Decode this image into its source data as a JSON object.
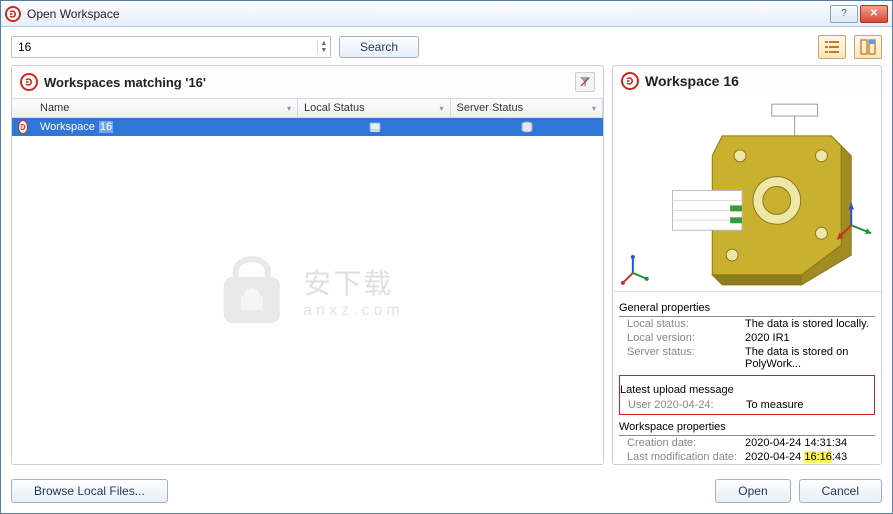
{
  "window": {
    "title": "Open Workspace"
  },
  "toolbar": {
    "search_value": "16",
    "search_btn": "Search"
  },
  "left_panel": {
    "title": "Workspaces matching '16'",
    "columns": {
      "name": "Name",
      "local": "Local Status",
      "server": "Server Status"
    },
    "rows": [
      {
        "name_prefix": "Workspace ",
        "name_hl": "16",
        "selected": true
      }
    ]
  },
  "watermark": {
    "main": "安下载",
    "sub": "anxz.com"
  },
  "right_panel": {
    "title": "Workspace 16",
    "sections": {
      "general": {
        "title": "General properties",
        "items": [
          {
            "k": "Local status:",
            "v": "The data is stored locally."
          },
          {
            "k": "Local version:",
            "v": "2020 IR1"
          },
          {
            "k": "Server status:",
            "v": "The data is stored on PolyWork..."
          }
        ]
      },
      "latest": {
        "title": "Latest upload message",
        "items": [
          {
            "k": "User 2020-04-24:",
            "v": "To measure"
          }
        ]
      },
      "workspace": {
        "title": "Workspace properties",
        "items": [
          {
            "k": "Creation date:",
            "v": "2020-04-24 14:31:34"
          },
          {
            "k": "Last modification date:",
            "v_pre": "2020-04-24 ",
            "v_hl": "16:16",
            "v_post": ":43"
          }
        ]
      }
    }
  },
  "footer": {
    "browse": "Browse Local Files...",
    "open": "Open",
    "cancel": "Cancel"
  }
}
